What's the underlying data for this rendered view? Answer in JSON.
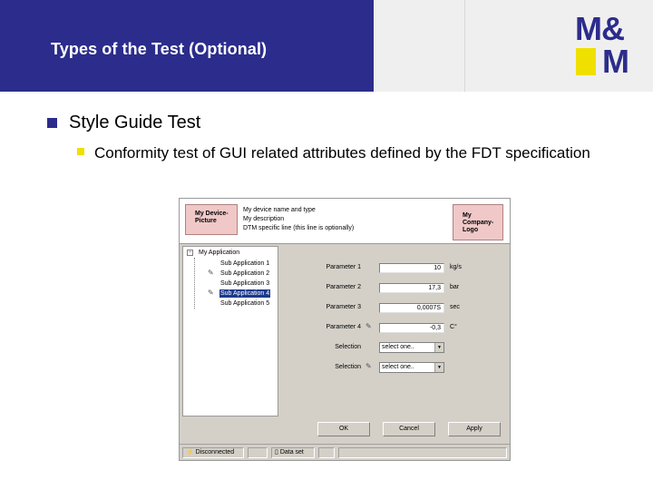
{
  "slide": {
    "title": "Types of the Test (Optional)",
    "logo": {
      "line1": "M&",
      "line2": "M"
    },
    "bullets": [
      {
        "text": "Style Guide Test",
        "children": [
          {
            "text": "Conformity test of GUI related attributes defined by the FDT specification"
          }
        ]
      }
    ]
  },
  "dtm_window": {
    "picture_box": "My Device-Picture",
    "description_lines": [
      "My device name and type",
      "My description",
      "DTM specific line (this line is optionally)"
    ],
    "company_logo_box": "My Company-Logo",
    "tree": {
      "root": "My Application",
      "expander": "−",
      "items": [
        {
          "label": "Sub Application 1",
          "selected": false,
          "edit_icon": false
        },
        {
          "label": "Sub Application 2",
          "selected": false,
          "edit_icon": true
        },
        {
          "label": "Sub Application 3",
          "selected": false,
          "edit_icon": false
        },
        {
          "label": "Sub Application 4",
          "selected": true,
          "edit_icon": true
        },
        {
          "label": "Sub Application 5",
          "selected": false,
          "edit_icon": false
        }
      ]
    },
    "parameters": [
      {
        "label": "Parameter 1",
        "value": "10",
        "unit": "kg/s"
      },
      {
        "label": "Parameter 2",
        "value": "17,3",
        "unit": "bar"
      },
      {
        "label": "Parameter 3",
        "value": "0,0007S",
        "unit": "sec"
      },
      {
        "label": "Parameter 4",
        "value": "-0,3",
        "unit": "C°"
      }
    ],
    "selections": [
      {
        "label": "Selection",
        "value": "select one.."
      },
      {
        "label": "Selection",
        "value": "select one.."
      }
    ],
    "buttons": {
      "ok": "OK",
      "cancel": "Cancel",
      "apply": "Apply"
    },
    "status": {
      "connection": "Disconnected",
      "dataset": "Data set"
    },
    "icons": {
      "edit": "pencil-icon",
      "dropdown": "dropdown-arrow-icon",
      "connection": "plug-icon",
      "dataset": "document-icon"
    }
  },
  "colors": {
    "header_blue": "#2c2c8c",
    "accent_yellow": "#f0e000",
    "header_gray": "#efefef",
    "window_gray": "#d4d0c8",
    "tree_selection": "#1c3a8c"
  }
}
